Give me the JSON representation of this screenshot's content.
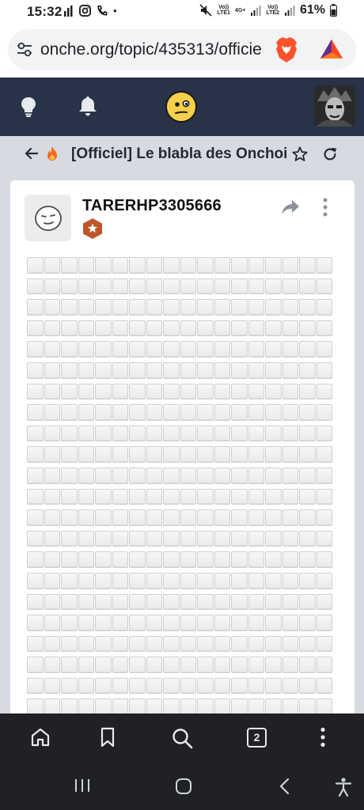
{
  "status_bar": {
    "time": "15:32",
    "battery_percent": "61%",
    "sim1_label_top": "Vo))",
    "sim1_label_bottom": "LTE1",
    "net_label_top": "4G+",
    "sim2_label_top": "Vo))",
    "sim2_label_bottom": "LTE2",
    "dot": "•"
  },
  "browser": {
    "url": "onche.org/topic/435313/officie",
    "tab_count": "2"
  },
  "site_header": {
    "icons": [
      "lightbulb-icon",
      "bell-icon",
      "smiley-logo-icon"
    ]
  },
  "topic": {
    "title": "[Officiel] Le blabla des Onchois"
  },
  "post": {
    "username": "TARERHP3305666",
    "grid_rows": 22,
    "grid_cols": 18
  },
  "colors": {
    "header_bg": "#293347",
    "page_bg": "#d7dbe1",
    "badge": "#c0552a",
    "toolbar_bg": "#202124"
  }
}
